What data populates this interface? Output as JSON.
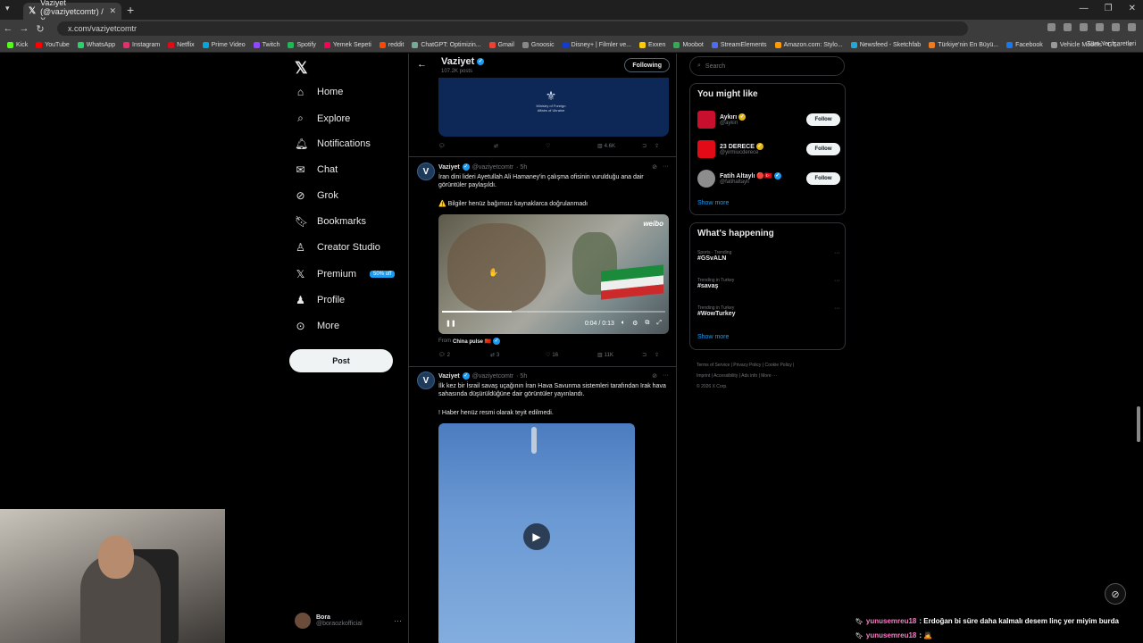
{
  "browser": {
    "tab_title": "Vaziyet (@vaziyetcomtr) / X",
    "url": "x.com/vaziyetcomtr",
    "bookmarks": [
      "Kick",
      "YouTube",
      "WhatsApp",
      "Instagram",
      "Netflix",
      "Prime Video",
      "Twitch",
      "Spotify",
      "Yemek Sepeti",
      "reddit",
      "ChatGPT: Optimizin...",
      "Gmail",
      "Gnoosic",
      "Disney+ | Filmler ve...",
      "Exxen",
      "Moobot",
      "StreamElements",
      "Amazon.com: Stylo...",
      "Newsfeed - Sketchfab",
      "Türkiye'nin En Büyü...",
      "Facebook",
      "Vehicle Models - GT..."
    ],
    "bookmarks_more": "»",
    "all_bookmarks": "Tüm Yer İşaretleri"
  },
  "nav": {
    "items": [
      {
        "label": "Home",
        "icon": "home-icon"
      },
      {
        "label": "Explore",
        "icon": "search-icon"
      },
      {
        "label": "Notifications",
        "icon": "bell-icon"
      },
      {
        "label": "Chat",
        "icon": "mail-icon"
      },
      {
        "label": "Grok",
        "icon": "grok-icon"
      },
      {
        "label": "Bookmarks",
        "icon": "bookmark-icon"
      },
      {
        "label": "Creator Studio",
        "icon": "creator-icon"
      },
      {
        "label": "Premium",
        "icon": "x-icon"
      },
      {
        "label": "Profile",
        "icon": "person-icon"
      },
      {
        "label": "More",
        "icon": "more-icon"
      }
    ],
    "premium_badge": "50% off",
    "post_label": "Post",
    "account_name": "Bora",
    "account_handle": "@boraozkofficial"
  },
  "profile_header": {
    "name": "Vaziyet",
    "posts": "107.2K posts",
    "following_label": "Following"
  },
  "tweet0": {
    "media_text": "Ministry of Foreign Affairs of Ukraine",
    "views": "4.6K"
  },
  "tweet1": {
    "name": "Vaziyet",
    "handle": "@vaziyetcomtr",
    "time": "· 5h",
    "text1": "İran dini lideri Ayetullah Ali Hamaney'in çalışma ofisinin vurulduğu ana dair görüntüler paylaşıldı.",
    "text2": "⚠️ Bilgiler henüz bağımsız kaynaklarca doğrulanmadı",
    "watermark": "weibo",
    "video_time": "0:04 / 0:13",
    "video_progress": 0.31,
    "from_label": "From",
    "from_name": "China pulse 🇨🇳",
    "replies": "2",
    "reposts": "3",
    "likes": "16",
    "views": "11K"
  },
  "tweet2": {
    "name": "Vaziyet",
    "handle": "@vaziyetcomtr",
    "time": "· 5h",
    "text1": "İlk kez bir İsrail savaş uçağının  İran Hava Savunma sistemleri tarafından Irak hava sahasında düşürüldüğüne dair görüntüler yayınlandı.",
    "text2": "! Haber henüz resmi olarak teyit edilmedi."
  },
  "search": {
    "placeholder": "Search"
  },
  "wtf": {
    "title": "You might like",
    "items": [
      {
        "name": "Aykırı",
        "handle": "@aykiri",
        "follow": "Follow"
      },
      {
        "name": "23 DERECE",
        "handle": "@yirmiucderece",
        "follow": "Follow"
      },
      {
        "name": "Fatih Altaylı 🔴🇹🇷",
        "handle": "@fatihaltayli",
        "follow": "Follow"
      }
    ],
    "show_more": "Show more"
  },
  "trends": {
    "title": "What's happening",
    "items": [
      {
        "meta": "Sports · Trending",
        "tag": "#GSvALN"
      },
      {
        "meta": "Trending in Turkey",
        "tag": "#savaş"
      },
      {
        "meta": "Trending in Turkey",
        "tag": "#WowTurkey"
      }
    ],
    "show_more": "Show more"
  },
  "footer": {
    "links1": "Terms of Service  |  Privacy Policy  |  Cookie Policy  |",
    "links2": "Imprint  |  Accessibility  |  Ads info  |  More ···",
    "copy": "© 2026 X Corp."
  },
  "chat_overlay": [
    {
      "user": "yunusemreu18",
      "msg": ": Erdoğan bi süre daha kalmalı desem linç yer miyim burda"
    },
    {
      "user": "yunusemreu18",
      "msg": ": 🙇"
    }
  ],
  "colors": {
    "accent": "#1d9bf0",
    "chat_user": "#ff7ac6"
  }
}
